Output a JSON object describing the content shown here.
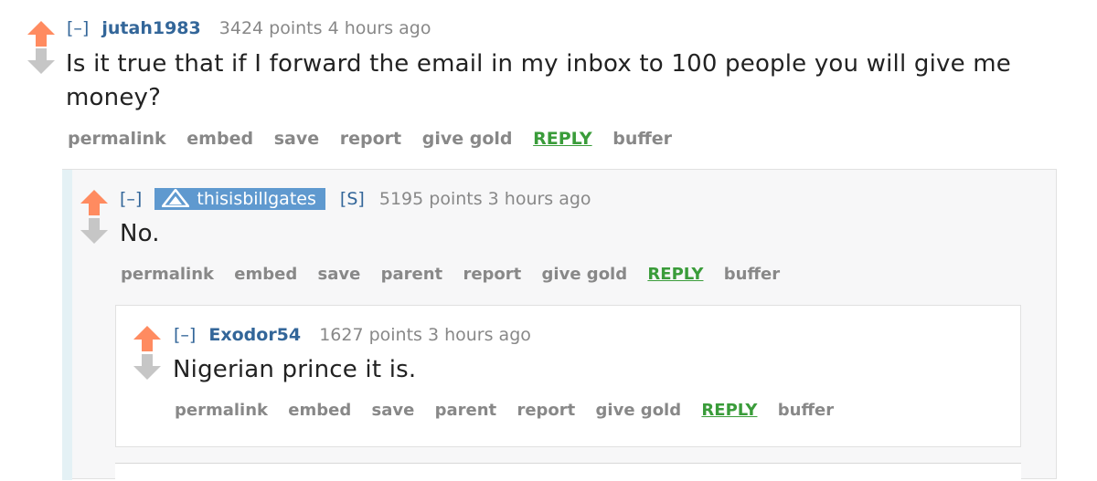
{
  "comments": [
    {
      "toggle": "[–]",
      "author": "jutah1983",
      "meta": "3424 points 4 hours ago",
      "body": "Is it true that if I forward the email in my inbox to 100 people you will give me money?",
      "buttons": {
        "permalink": "permalink",
        "embed": "embed",
        "save": "save",
        "report": "report",
        "give_gold": "give gold",
        "reply": "REPLY",
        "buffer": "buffer"
      }
    },
    {
      "toggle": "[–]",
      "author": "thisisbillgates",
      "submitter_tag": "[S]",
      "meta": "5195 points 3 hours ago",
      "body": "No.",
      "buttons": {
        "permalink": "permalink",
        "embed": "embed",
        "save": "save",
        "parent": "parent",
        "report": "report",
        "give_gold": "give gold",
        "reply": "REPLY",
        "buffer": "buffer"
      }
    },
    {
      "toggle": "[–]",
      "author": "Exodor54",
      "meta": "1627 points 3 hours ago",
      "body": "Nigerian prince it is.",
      "buttons": {
        "permalink": "permalink",
        "embed": "embed",
        "save": "save",
        "parent": "parent",
        "report": "report",
        "give_gold": "give gold",
        "reply": "REPLY",
        "buffer": "buffer"
      }
    }
  ],
  "colors": {
    "upvote": "#ff8b60",
    "downvote": "#c6c6c6",
    "author": "#336699",
    "reply": "#3a9c3a",
    "muted": "#888888",
    "flair_bg": "#5f99cf"
  },
  "icons": {
    "upvote": "upvote-arrow-icon",
    "downvote": "downvote-arrow-icon",
    "admin_flair": "admin-triangle-icon"
  }
}
